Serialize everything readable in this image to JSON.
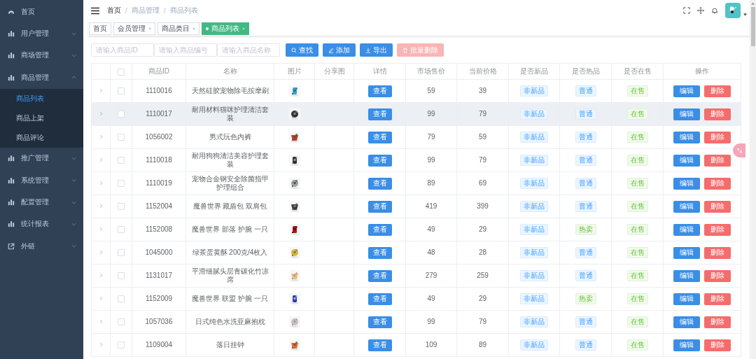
{
  "sidebar": {
    "items": [
      {
        "label": "首页",
        "kind": "page"
      },
      {
        "label": "用户管理",
        "kind": "group",
        "expanded": false
      },
      {
        "label": "商场管理",
        "kind": "group",
        "expanded": false
      },
      {
        "label": "商品管理",
        "kind": "group",
        "expanded": true,
        "children": [
          {
            "label": "商品列表",
            "selected": true
          },
          {
            "label": "商品上架",
            "selected": false
          },
          {
            "label": "商品评论",
            "selected": false
          }
        ]
      },
      {
        "label": "推广管理",
        "kind": "group",
        "expanded": false
      },
      {
        "label": "系统管理",
        "kind": "group",
        "expanded": false
      },
      {
        "label": "配置管理",
        "kind": "group",
        "expanded": false
      },
      {
        "label": "统计报表",
        "kind": "group",
        "expanded": false
      },
      {
        "label": "外链",
        "kind": "link",
        "expanded": false
      }
    ]
  },
  "breadcrumb": [
    {
      "label": "首页",
      "separator": "/"
    },
    {
      "label": "商品管理",
      "separator": "/"
    },
    {
      "label": "商品列表"
    }
  ],
  "tags": [
    {
      "label": "首页",
      "selected": false,
      "closable": false
    },
    {
      "label": "会员管理",
      "selected": false,
      "closable": true
    },
    {
      "label": "商品类目",
      "selected": false,
      "closable": true
    },
    {
      "label": "商品列表",
      "selected": true,
      "closable": true
    }
  ],
  "search": {
    "fields": [
      {
        "placeholder": "请输入商品ID"
      },
      {
        "placeholder": "请输入商品编号"
      },
      {
        "placeholder": "请输入商品名称"
      }
    ],
    "buttons": [
      {
        "label": "查找",
        "kind": "search",
        "disabled": false
      },
      {
        "label": "添加",
        "kind": "add",
        "disabled": false
      },
      {
        "label": "导出",
        "kind": "export",
        "disabled": false
      },
      {
        "label": "批量删除",
        "kind": "delete",
        "disabled": true
      }
    ]
  },
  "table": {
    "header_checked": false,
    "columns": [
      {
        "label": "商品ID"
      },
      {
        "label": "名称"
      },
      {
        "label": "图片"
      },
      {
        "label": "分享图"
      },
      {
        "label": "详情"
      },
      {
        "label": "市场售价"
      },
      {
        "label": "当前价格"
      },
      {
        "label": "是否新品"
      },
      {
        "label": "是否热品"
      },
      {
        "label": "是否在售"
      },
      {
        "label": "操作"
      }
    ],
    "rows": [
      {
        "id": "1110016",
        "name": "天然硅胶宠物除毛按摩刷",
        "detail": "查看",
        "market_price": "59",
        "current_price": "39",
        "new": "非新品",
        "hot": {
          "label": "普通",
          "kind": "normal"
        },
        "sale": "在售",
        "actions": [
          "编辑",
          "删除"
        ],
        "checked": false,
        "highlighted": false
      },
      {
        "id": "1110017",
        "name": "耐用材料猫咪护理清洁套装",
        "detail": "查看",
        "market_price": "99",
        "current_price": "79",
        "new": "非新品",
        "hot": {
          "label": "普通",
          "kind": "normal"
        },
        "sale": "在售",
        "actions": [
          "编辑",
          "删除"
        ],
        "checked": false,
        "highlighted": true
      },
      {
        "id": "1056002",
        "name": "男式玩色内裤",
        "detail": "查看",
        "market_price": "79",
        "current_price": "59",
        "new": "非新品",
        "hot": {
          "label": "普通",
          "kind": "normal"
        },
        "sale": "在售",
        "actions": [
          "编辑",
          "删除"
        ],
        "checked": false,
        "highlighted": false
      },
      {
        "id": "1110018",
        "name": "耐用狗狗清洁美容护理套装",
        "detail": "查看",
        "market_price": "99",
        "current_price": "79",
        "new": "非新品",
        "hot": {
          "label": "普通",
          "kind": "normal"
        },
        "sale": "在售",
        "actions": [
          "编辑",
          "删除"
        ],
        "checked": false,
        "highlighted": false
      },
      {
        "id": "1110019",
        "name": "宠物合金钢安全除菌指甲护理组合",
        "detail": "查看",
        "market_price": "89",
        "current_price": "69",
        "new": "非新品",
        "hot": {
          "label": "普通",
          "kind": "normal"
        },
        "sale": "在售",
        "actions": [
          "编辑",
          "删除"
        ],
        "checked": false,
        "highlighted": false
      },
      {
        "id": "1152004",
        "name": "魔兽世界 藏盾包 双肩包",
        "detail": "查看",
        "market_price": "419",
        "current_price": "399",
        "new": "非新品",
        "hot": {
          "label": "普通",
          "kind": "normal"
        },
        "sale": "在售",
        "actions": [
          "编辑",
          "删除"
        ],
        "checked": false,
        "highlighted": false
      },
      {
        "id": "1152008",
        "name": "魔兽世界 部落 护腕 一只",
        "detail": "查看",
        "market_price": "49",
        "current_price": "29",
        "new": "非新品",
        "hot": {
          "label": "热卖",
          "kind": "hot"
        },
        "sale": "在售",
        "actions": [
          "编辑",
          "删除"
        ],
        "checked": false,
        "highlighted": false
      },
      {
        "id": "1045000",
        "name": "绿茶蛋黄酥 200克/4枚入",
        "detail": "查看",
        "market_price": "48",
        "current_price": "28",
        "new": "非新品",
        "hot": {
          "label": "普通",
          "kind": "normal"
        },
        "sale": "在售",
        "actions": [
          "编辑",
          "删除"
        ],
        "checked": false,
        "highlighted": false
      },
      {
        "id": "1131017",
        "name": "平滑细腻头层青碳化竹凉席",
        "detail": "查看",
        "market_price": "279",
        "current_price": "259",
        "new": "非新品",
        "hot": {
          "label": "普通",
          "kind": "normal"
        },
        "sale": "在售",
        "actions": [
          "编辑",
          "删除"
        ],
        "checked": false,
        "highlighted": false
      },
      {
        "id": "1152009",
        "name": "魔兽世界 联盟 护腕 一只",
        "detail": "查看",
        "market_price": "49",
        "current_price": "29",
        "new": "非新品",
        "hot": {
          "label": "热卖",
          "kind": "hot"
        },
        "sale": "在售",
        "actions": [
          "编辑",
          "删除"
        ],
        "checked": false,
        "highlighted": false
      },
      {
        "id": "1057036",
        "name": "日式纯色水洗亚麻抱枕",
        "detail": "查看",
        "market_price": "99",
        "current_price": "79",
        "new": "非新品",
        "hot": {
          "label": "普通",
          "kind": "normal"
        },
        "sale": "在售",
        "actions": [
          "编辑",
          "删除"
        ],
        "checked": false,
        "highlighted": false
      },
      {
        "id": "1109004",
        "name": "落日挂钟",
        "detail": "查看",
        "market_price": "109",
        "current_price": "89",
        "new": "非新品",
        "hot": {
          "label": "普通",
          "kind": "normal"
        },
        "sale": "在售",
        "actions": [
          "编辑",
          "删除"
        ],
        "checked": false,
        "highlighted": false
      }
    ]
  }
}
